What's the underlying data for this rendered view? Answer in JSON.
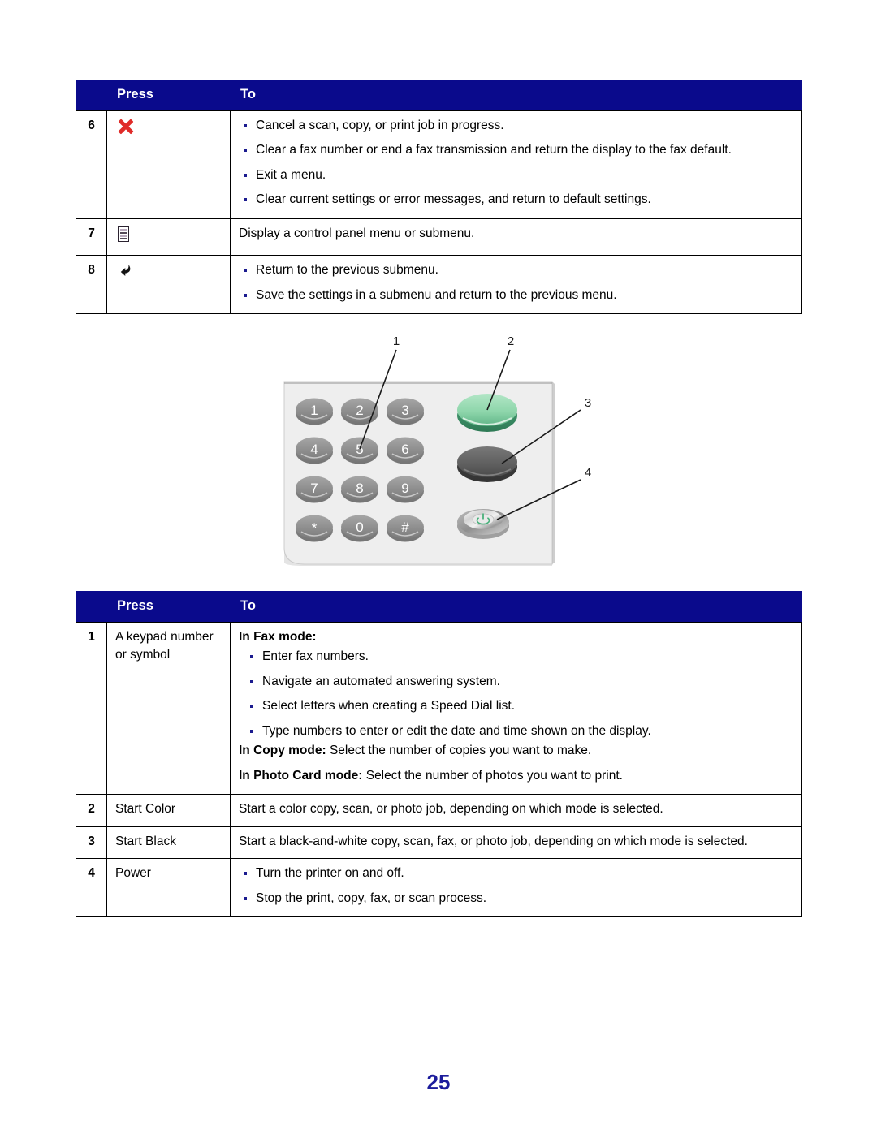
{
  "document": {
    "page_number": "25",
    "accent_color": "#0a0a8c",
    "bullet_color": "#1b1b8f",
    "cancel_icon_color": "#e02b28"
  },
  "table_top": {
    "headers": {
      "num": "",
      "press": "Press",
      "to": "To"
    },
    "rows": [
      {
        "num": "6",
        "press_icon": "cancel-x-icon",
        "press_label": "",
        "bullets": [
          "Cancel a scan, copy, or print job in progress.",
          "Clear a fax number or end a fax transmission and return the display to the fax default.",
          "Exit a menu.",
          "Clear current settings or error messages, and return to default settings."
        ]
      },
      {
        "num": "7",
        "press_icon": "menu-icon",
        "press_label": "",
        "plain": "Display a control panel menu or submenu."
      },
      {
        "num": "8",
        "press_icon": "back-arrow-icon",
        "press_label": "",
        "bullets": [
          "Return to the previous submenu.",
          "Save the settings in a submenu and return to the previous menu."
        ]
      }
    ]
  },
  "figure": {
    "name": "control-panel-keypad-illustration",
    "callouts": [
      "1",
      "2",
      "3",
      "4"
    ],
    "keypad_keys": [
      "1",
      "2",
      "3",
      "4",
      "5",
      "6",
      "7",
      "8",
      "9",
      "*",
      "0",
      "#"
    ],
    "buttons": [
      {
        "name": "start-color-button",
        "color": "#8ed6ab"
      },
      {
        "name": "start-black-button",
        "color": "#666666"
      },
      {
        "name": "power-button",
        "color": "#d8d8d8"
      }
    ]
  },
  "table_bottom": {
    "headers": {
      "num": "",
      "press": "Press",
      "to": "To"
    },
    "rows": [
      {
        "num": "1",
        "press": "A keypad number or symbol",
        "mode_heading": "In Fax mode:",
        "bullets": [
          "Enter fax numbers.",
          "Navigate an automated answering system.",
          "Select letters when creating a Speed Dial list.",
          "Type numbers to enter or edit the date and time shown on the display."
        ],
        "mode_lines": [
          {
            "bold": "In Copy mode:",
            "rest": " Select the number of copies you want to make."
          },
          {
            "bold": "In Photo Card mode:",
            "rest": " Select the number of photos you want to print."
          }
        ]
      },
      {
        "num": "2",
        "press": "Start Color",
        "plain": "Start a color copy, scan, or photo job, depending on which mode is selected."
      },
      {
        "num": "3",
        "press": "Start Black",
        "plain": "Start a black-and-white copy, scan, fax, or photo job, depending on which mode is selected."
      },
      {
        "num": "4",
        "press": "Power",
        "bullets": [
          "Turn the printer on and off.",
          "Stop the print, copy, fax, or scan process."
        ]
      }
    ]
  }
}
